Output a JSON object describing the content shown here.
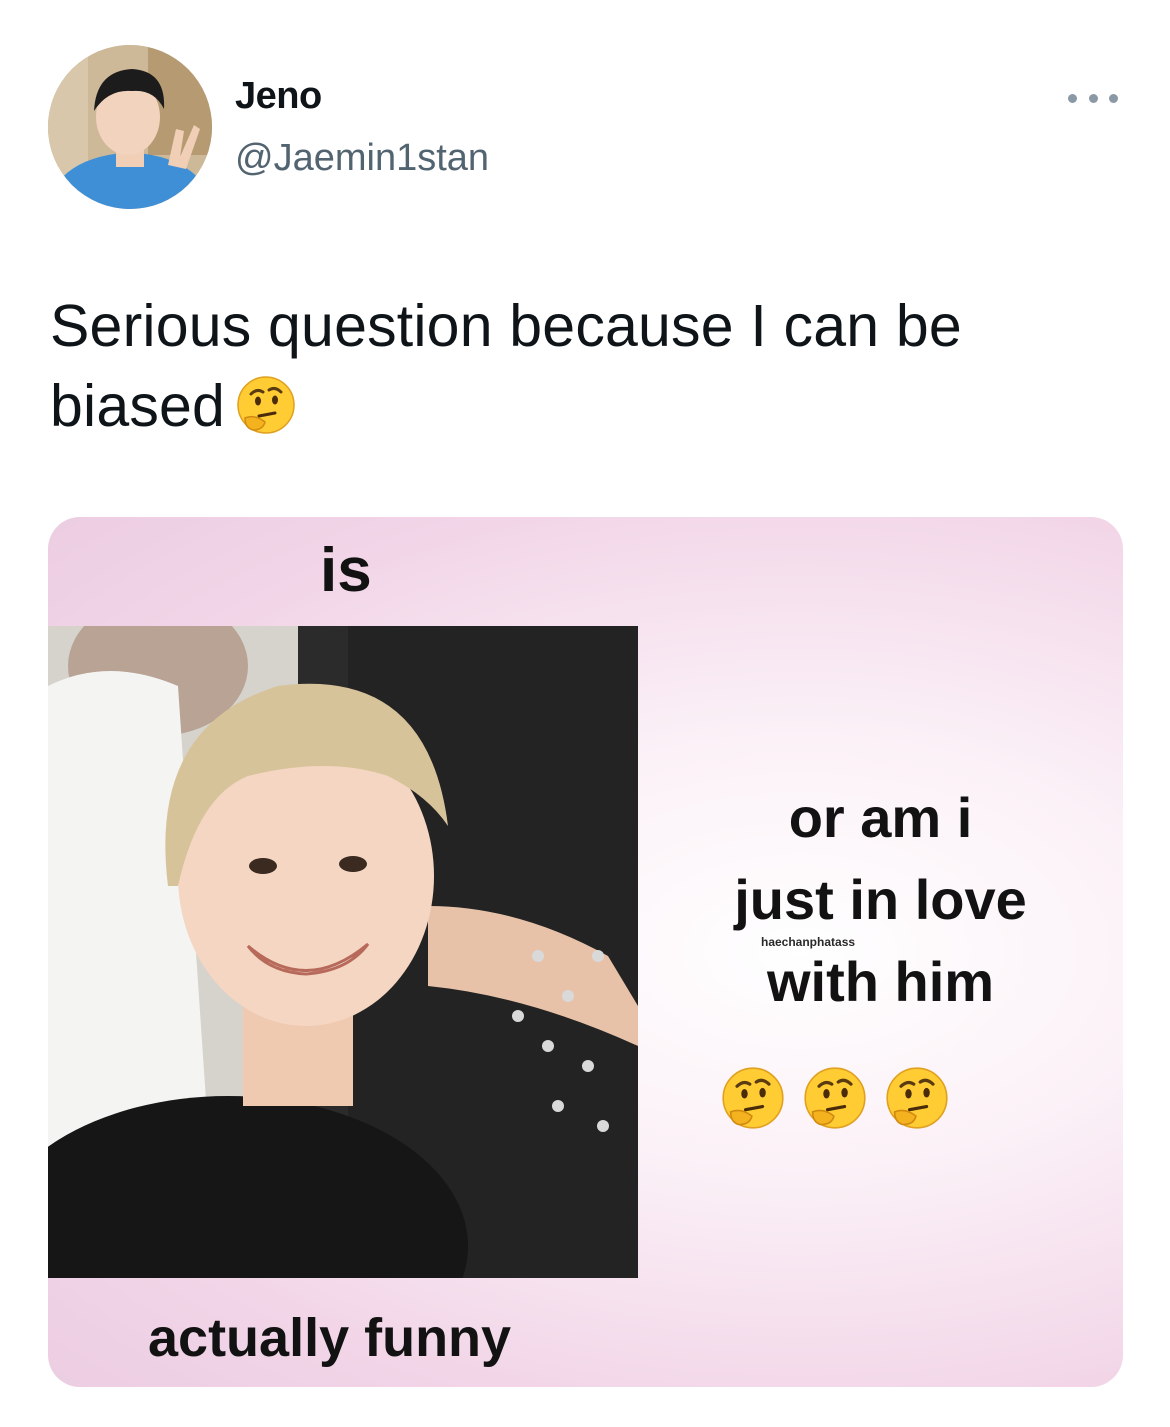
{
  "tweet": {
    "author_name": "Jeno",
    "author_handle": "@Jaemin1stan",
    "text": "Serious question because I can be biased",
    "text_emoji": "thinking-face-emoji"
  },
  "header": {
    "more_icon": "more-options-icon"
  },
  "meme": {
    "top_word": "is",
    "right_lines": [
      "or am i",
      "just in love",
      "with him"
    ],
    "watermark": "haechanphatass",
    "emoji_count": 3,
    "emoji_icon": "thinking-face-emoji",
    "bottom_text": "actually funny",
    "photo_subject": "smiling person with blond hair"
  },
  "colors": {
    "handle": "#536471",
    "text": "#0f1419",
    "card_background": "#f2d6e8",
    "more_dots": "#8b98a5"
  }
}
